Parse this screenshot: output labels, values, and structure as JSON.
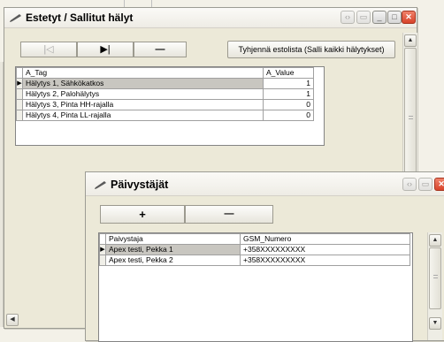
{
  "window1": {
    "title": "Estetyt / Sallitut hälyt",
    "toolbar": {
      "first_label": "|◁",
      "next_label": "▶|",
      "delete_label": "—",
      "clear_label": "Tyhjennä estolista (Salli kaikki hälytykset)"
    },
    "grid": {
      "columns": [
        "A_Tag",
        "A_Value"
      ],
      "rows": [
        {
          "tag": "Hälytys 1, Sähkökatkos",
          "value": "1"
        },
        {
          "tag": "Hälytys 2, Palohälytys",
          "value": "1"
        },
        {
          "tag": "Hälytys 3, Pinta HH-rajalla",
          "value": "0"
        },
        {
          "tag": "Hälytys 4, Pinta LL-rajalla",
          "value": "0"
        }
      ]
    }
  },
  "window2": {
    "title": "Päivystäjät",
    "toolbar": {
      "add_label": "+",
      "delete_label": "—"
    },
    "grid": {
      "columns": [
        "Paivystaja",
        "GSM_Numero"
      ],
      "rows": [
        {
          "name": "Apex testi, Pekka 1",
          "gsm": "+358XXXXXXXXX"
        },
        {
          "name": "Apex testi, Pekka 2",
          "gsm": "+358XXXXXXXXX"
        }
      ]
    }
  },
  "row_pointer": "▶"
}
